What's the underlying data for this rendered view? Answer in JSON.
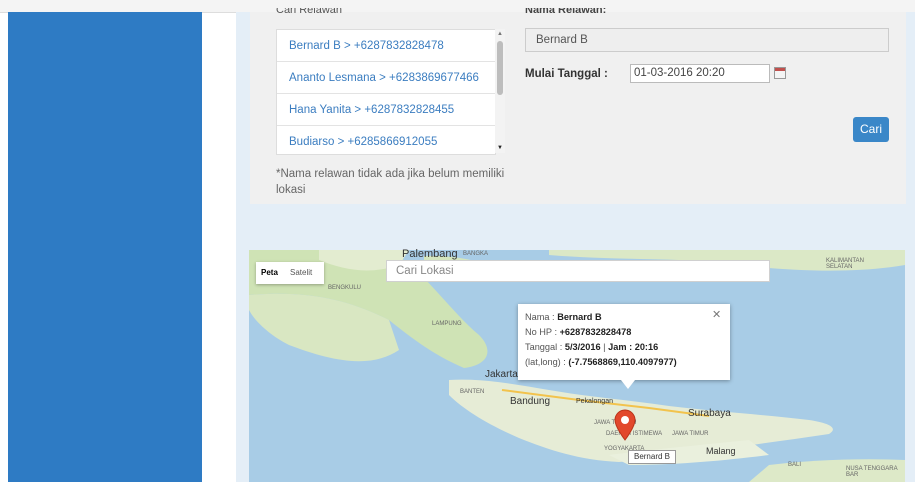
{
  "form": {
    "list_label": "Cari Relawan",
    "volunteers": [
      "Bernard B > +6287832828478",
      "Ananto Lesmana > +6283869677466",
      "Hana Yanita > +6287832828455",
      "Budiarso > +6285866912055"
    ],
    "note": "*Nama relawan tidak ada jika belum memiliki lokasi",
    "name_label": "Nama Relawan:",
    "name_value": "Bernard B",
    "date_label": "Mulai Tanggal :",
    "date_value": "01-03-2016 20:20",
    "search_button": "Cari"
  },
  "map": {
    "toggle_map": "Peta",
    "toggle_satellite": "Satelit",
    "search_placeholder": "Cari Lokasi",
    "labels": {
      "palembang": "Palembang",
      "bangka": "BANGKA",
      "bengkulu": "BENGKULU",
      "lampung": "LAMPUNG",
      "jakarta": "Jakarta",
      "banten": "BANTEN",
      "bandung": "Bandung",
      "pekalongan": "Pekalongan",
      "surabaya": "Surabaya",
      "jawa_tengah": "JAWA TENGAH",
      "jawa_timur": "JAWA TIMUR",
      "daerah_istimewa": "DAERAH ISTIMEWA",
      "yogyakarta": "YOGYAKARTA",
      "malang": "Malang",
      "bali": "BALI",
      "kalimantan": "KALIMANTAN SELATAN",
      "nusa": "NUSA TENGGARA BAR"
    },
    "popup": {
      "name_label": "Nama :",
      "name": "Bernard B",
      "phone_label": "No HP :",
      "phone": "+6287832828478",
      "date_label": "Tanggal :",
      "date": "5/3/2016",
      "time_label": "Jam :",
      "time": "20:16",
      "coord_label": "(lat,long) :",
      "coord": "(-7.7568869,110.4097977)"
    },
    "marker_label": "Bernard B"
  },
  "colors": {
    "sidebar": "#2e7bc4",
    "button": "#3a87c8",
    "link": "#3b7dc0",
    "marker": "#e2482c"
  }
}
